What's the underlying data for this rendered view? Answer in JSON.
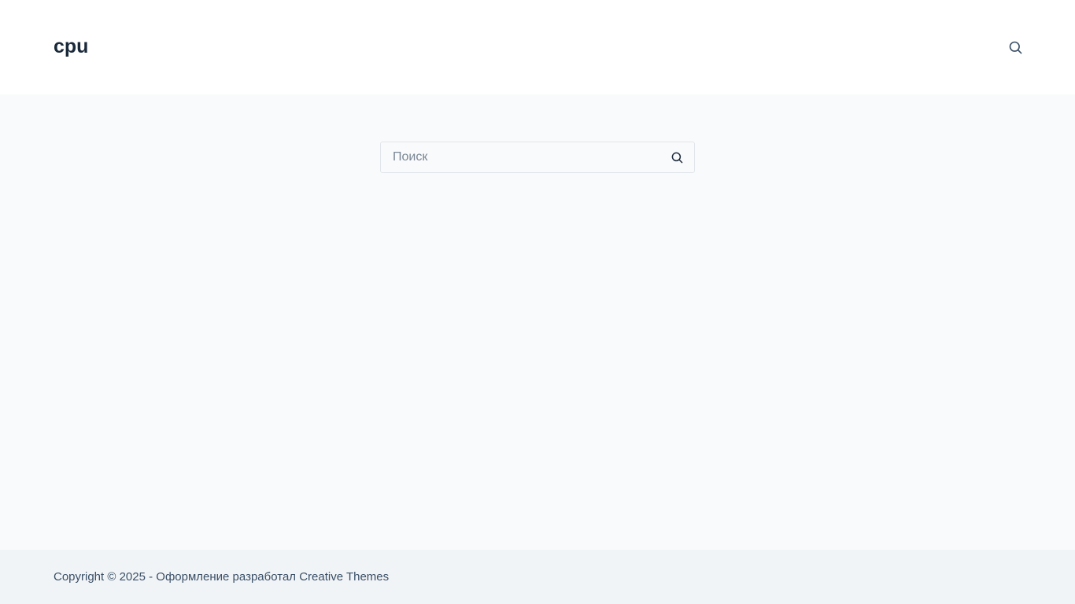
{
  "header": {
    "site_title": "cpu",
    "search_icon": "search-icon"
  },
  "main": {
    "search": {
      "placeholder": "Поиск",
      "value": "",
      "submit_icon": "search-icon"
    }
  },
  "footer": {
    "copyright_prefix": "Copyright © 2025 - Оформление разработал ",
    "credit_link": "Creative Themes"
  },
  "colors": {
    "header_bg": "#ffffff",
    "page_bg": "#f9fafb",
    "footer_bg": "#f1f4f7",
    "title_text": "#1b2a3b",
    "body_text": "#3a4f66"
  }
}
